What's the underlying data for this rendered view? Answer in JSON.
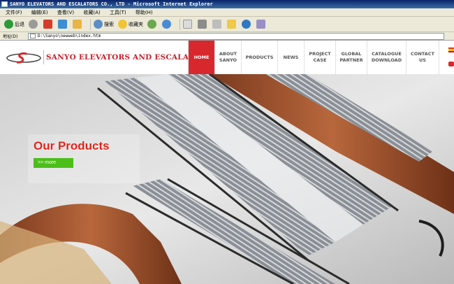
{
  "window": {
    "title": "SANYO ELEVATORS AND ESCALATORS CO., LTD - Microsoft Internet Explorer"
  },
  "menubar": {
    "items": [
      "文件(F)",
      "编辑(E)",
      "查看(V)",
      "收藏(A)",
      "工具(T)",
      "帮助(H)"
    ]
  },
  "toolbar": {
    "back_label": "后退",
    "search_label": "搜索",
    "favorites_label": "收藏夹"
  },
  "addressbar": {
    "label": "地址(D)",
    "value": "D:\\Sanyo\\newweb\\index.htm"
  },
  "site": {
    "logo_text": "SANYO ELEVATORS AND ESCALATORS",
    "brand_color": "#d8282e",
    "nav": {
      "home": "HOME",
      "about": "ABOUT SANYO",
      "products": "PRODUCTS",
      "news": "NEWS",
      "project": "PROJECT CASE",
      "global": "GLOBAL PARTNER",
      "catalogue": "CATALOGUE DOWNLOAD",
      "contact": "CONTACT US"
    },
    "active_nav": "home"
  },
  "hero": {
    "title": "Our Products",
    "more_label": ">> more",
    "title_color": "#e2231a",
    "more_color": "#4cbe1a"
  }
}
